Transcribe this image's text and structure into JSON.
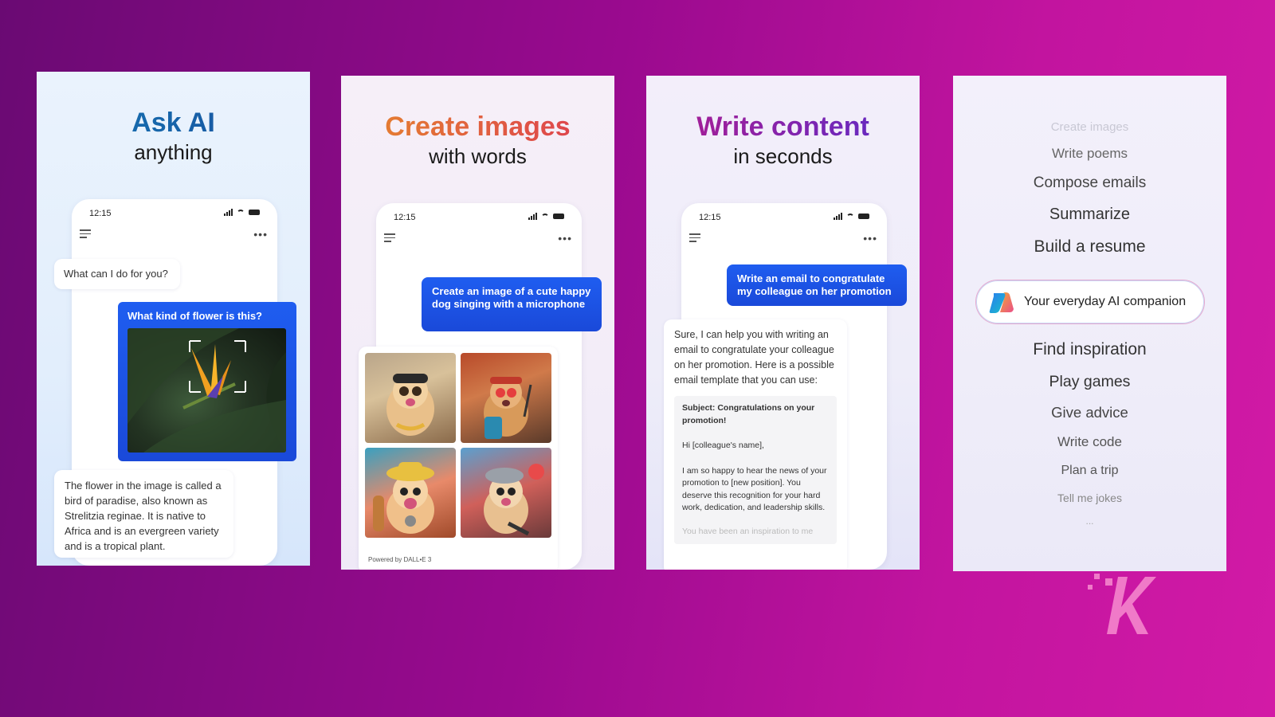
{
  "card1": {
    "title": "Ask AI",
    "subtitle": "anything",
    "time": "12:15",
    "prompt": "What can I do for you?",
    "question": "What kind of flower is this?",
    "answer": "The flower in the image is called a bird of paradise, also known as Strelitzia reginae. It is native to Africa and is an evergreen variety and is a tropical plant."
  },
  "card2": {
    "title": "Create images",
    "subtitle": "with words",
    "time": "12:15",
    "request": "Create an image of a cute happy dog singing with a microphone",
    "powered": "Powered by DALL•E 3"
  },
  "card3": {
    "title": "Write content",
    "subtitle": "in seconds",
    "time": "12:15",
    "request": "Write an email to congratulate my colleague on her promotion",
    "reply": "Sure, I can help you with writing an email to congratulate your colleague on her promotion. Here is a possible email template that you can use:",
    "email_subject": "Subject: Congratulations on your promotion!",
    "email_greeting": "Hi [colleague's name],",
    "email_body": "I am so happy to hear the news of your promotion to [new position]. You deserve this recognition for your hard work, dedication, and leadership skills.",
    "email_fade": "You have been an inspiration to me"
  },
  "card4": {
    "items_top": [
      "Create images",
      "Write poems",
      "Compose emails",
      "Summarize",
      "Build a resume"
    ],
    "companion": "Your everyday AI companion",
    "items_bottom": [
      "Find inspiration",
      "Play games",
      "Give advice",
      "Write code",
      "Plan a trip",
      "Tell me jokes",
      "..."
    ]
  },
  "watermark": "K",
  "colors": {
    "accent_blue": "#1f5df0",
    "bg_purple": "#9a0a8f",
    "bg_magenta": "#d21aa6"
  }
}
